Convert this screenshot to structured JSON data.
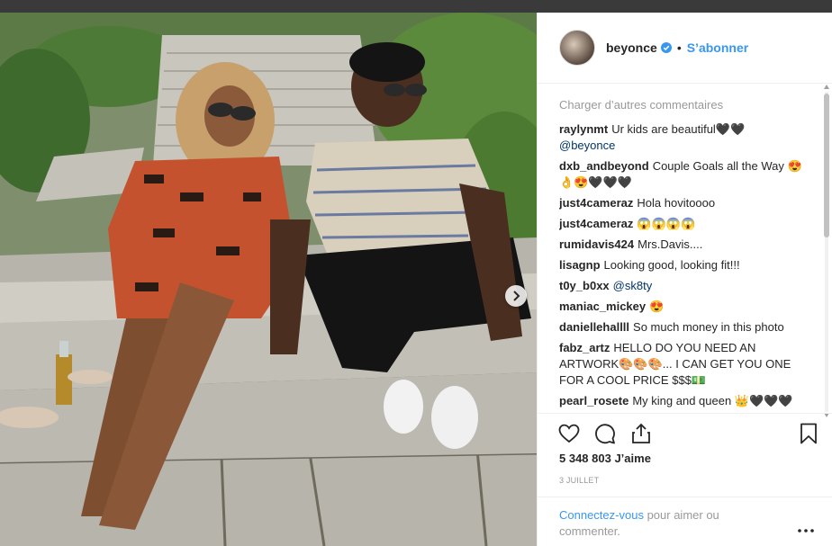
{
  "post": {
    "username": "beyonce",
    "separator": "•",
    "follow_label": "S’abonner",
    "load_more": "Charger d’autres commentaires",
    "comments": [
      {
        "user": "raylynmt",
        "text": "Ur kids are beautiful🖤🖤",
        "mention": "@beyonce"
      },
      {
        "user": "dxb_andbeyond",
        "text": "Couple Goals all the Way 😍👌😍🖤🖤🖤"
      },
      {
        "user": "just4cameraz",
        "text": "Hola hovitoooo"
      },
      {
        "user": "just4cameraz",
        "text": "😱😱😱😱"
      },
      {
        "user": "rumidavis424",
        "text": "Mrs.Davis...."
      },
      {
        "user": "lisagnp",
        "text": "Looking good, looking fit!!!"
      },
      {
        "user": "t0y_b0xx",
        "mention": "@sk8ty"
      },
      {
        "user": "maniac_mickey",
        "text": "😍"
      },
      {
        "user": "daniellehallll",
        "text": "So much money in this photo"
      },
      {
        "user": "fabz_artz",
        "text": "HELLO DO YOU NEED AN ARTWORK🎨🎨🎨... I CAN GET YOU ONE FOR A COOL PRICE $$$💵"
      },
      {
        "user": "pearl_rosete",
        "text": "My king and queen 👑🖤🖤🖤"
      }
    ],
    "likes": "5 348 803 J’aime",
    "date": "3 JUILLET",
    "login_link": "Connectez-vous",
    "login_text": " pour aimer ou commenter."
  },
  "icons": {
    "like": "heart-icon",
    "comment": "comment-icon",
    "share": "share-icon",
    "save": "bookmark-icon",
    "more": "more-options-icon",
    "verified": "verified-badge-icon",
    "next": "chevron-right-icon"
  },
  "colors": {
    "accent": "#3897f0",
    "text": "#262626",
    "muted": "#999999",
    "mention": "#003569"
  },
  "carousel": {
    "count": 4,
    "active": 1
  }
}
